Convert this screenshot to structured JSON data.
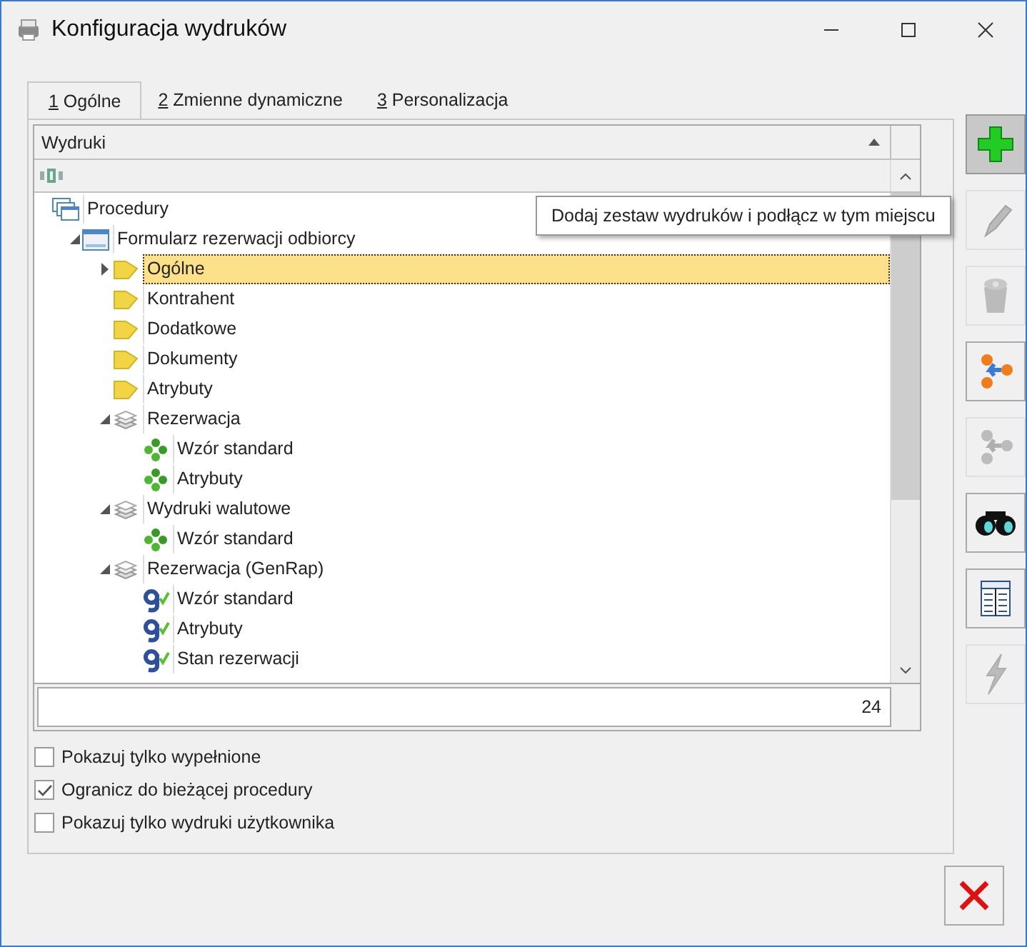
{
  "window": {
    "title": "Konfiguracja wydruków"
  },
  "tabs": [
    {
      "number": "1",
      "label": "Ogólne",
      "selected": true
    },
    {
      "number": "2",
      "label": "Zmienne dynamiczne",
      "selected": false
    },
    {
      "number": "3",
      "label": "Personalizacja",
      "selected": false
    }
  ],
  "tree": {
    "column": "Wydruki",
    "count": "24",
    "items": [
      {
        "label": "Procedury",
        "kind": "procedures",
        "selected": false,
        "children": [
          {
            "label": "Formularz rezerwacji odbiorcy",
            "kind": "form",
            "expanded": true,
            "selected": false,
            "children": [
              {
                "label": "Ogólne",
                "kind": "folder",
                "expanded": false,
                "selected": true
              },
              {
                "label": "Kontrahent",
                "kind": "folder",
                "selected": false
              },
              {
                "label": "Dodatkowe",
                "kind": "folder",
                "selected": false
              },
              {
                "label": "Dokumenty",
                "kind": "folder",
                "selected": false
              },
              {
                "label": "Atrybuty",
                "kind": "folder",
                "selected": false
              },
              {
                "label": "Rezerwacja",
                "kind": "stack",
                "expanded": true,
                "selected": false,
                "children": [
                  {
                    "label": "Wzór standard",
                    "kind": "template",
                    "selected": false
                  },
                  {
                    "label": "Atrybuty",
                    "kind": "template",
                    "selected": false
                  }
                ]
              },
              {
                "label": "Wydruki walutowe",
                "kind": "stack",
                "expanded": true,
                "selected": false,
                "children": [
                  {
                    "label": "Wzór standard",
                    "kind": "template",
                    "selected": false
                  }
                ]
              },
              {
                "label": "Rezerwacja (GenRap)",
                "kind": "stack",
                "expanded": true,
                "selected": false,
                "children": [
                  {
                    "label": "Wzór standard",
                    "kind": "genrap",
                    "selected": false
                  },
                  {
                    "label": "Atrybuty",
                    "kind": "genrap",
                    "selected": false
                  },
                  {
                    "label": "Stan rezerwacji",
                    "kind": "genrap",
                    "selected": false
                  }
                ]
              }
            ]
          }
        ]
      }
    ]
  },
  "tooltip": "Dodaj zestaw wydruków i podłącz w tym miejscu",
  "tools": [
    {
      "kind": "add",
      "disabled": false,
      "hovered": true
    },
    {
      "kind": "edit",
      "disabled": true,
      "hovered": false
    },
    {
      "kind": "delete",
      "disabled": true,
      "hovered": false
    },
    {
      "kind": "connect",
      "disabled": false,
      "hovered": false
    },
    {
      "kind": "disconnect",
      "disabled": true,
      "hovered": false
    },
    {
      "kind": "find",
      "disabled": false,
      "hovered": false
    },
    {
      "kind": "table",
      "disabled": false,
      "hovered": false
    },
    {
      "kind": "run",
      "disabled": true,
      "hovered": false
    }
  ],
  "options": [
    {
      "label": "Pokazuj tylko wypełnione",
      "checked": false
    },
    {
      "label": "Ogranicz do bieżącej procedury",
      "checked": true
    },
    {
      "label": "Pokazuj tylko wydruki użytkownika",
      "checked": false
    }
  ]
}
